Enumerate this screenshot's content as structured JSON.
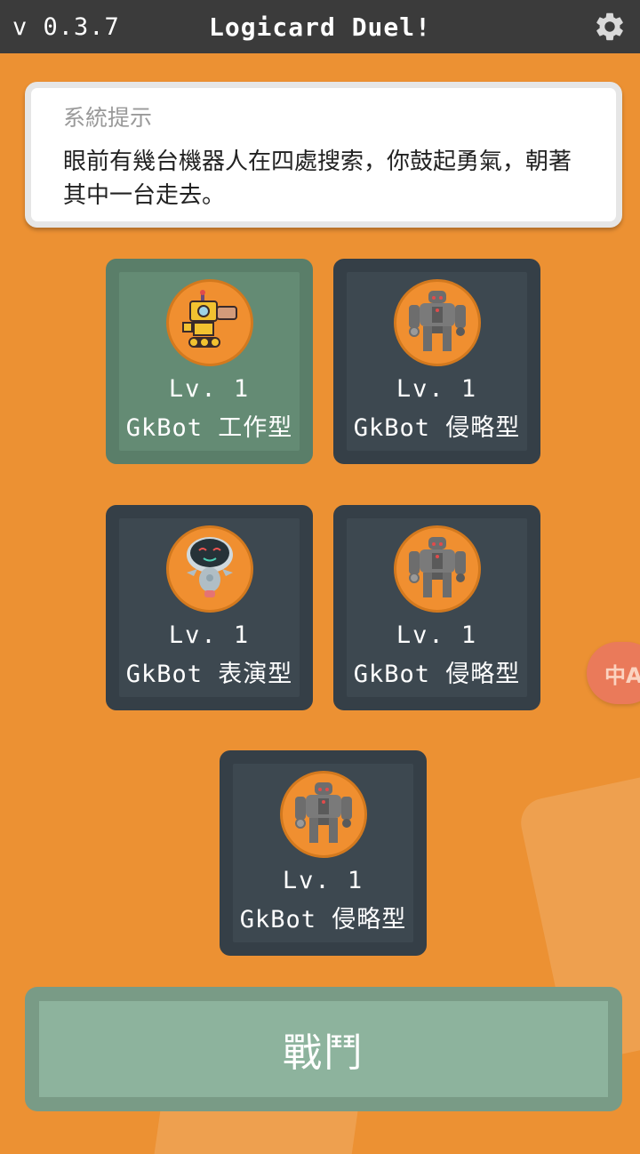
{
  "topbar": {
    "version": "v 0.3.7",
    "title": "Logicard Duel!",
    "settings_icon": "gear-icon"
  },
  "system": {
    "label": "系統提示",
    "message": "眼前有幾台機器人在四處搜索，你鼓起勇氣，朝著其中一台走去。"
  },
  "bots": [
    {
      "level": "Lv. 1",
      "name": "GkBot 工作型",
      "icon": "worker-robot-icon",
      "selected": true
    },
    {
      "level": "Lv. 1",
      "name": "GkBot 侵略型",
      "icon": "invader-robot-icon",
      "selected": false
    },
    {
      "level": "Lv. 1",
      "name": "GkBot 表演型",
      "icon": "performer-robot-icon",
      "selected": false
    },
    {
      "level": "Lv. 1",
      "name": "GkBot 侵略型",
      "icon": "invader-robot-icon",
      "selected": false
    },
    {
      "level": "Lv. 1",
      "name": "GkBot 侵略型",
      "icon": "invader-robot-icon",
      "selected": false
    }
  ],
  "translate": {
    "label": "中A",
    "icon": "translate-icon"
  },
  "fight": {
    "label": "戰鬥"
  },
  "colors": {
    "background": "#ec9133",
    "topbar": "#3b3b3b",
    "card": "#353f47",
    "card_selected": "#5a7e69",
    "fight_button": "#8db39d"
  }
}
